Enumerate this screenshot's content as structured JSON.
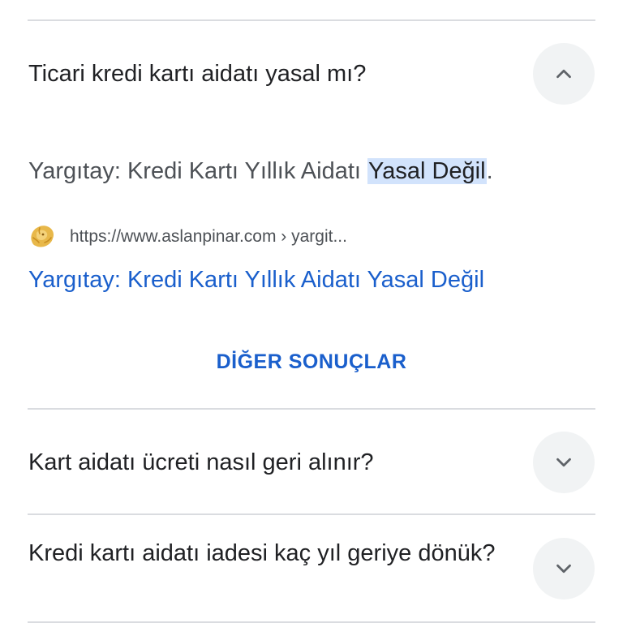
{
  "faq": {
    "q1": {
      "question": "Ticari kredi kartı aidatı yasal mı?",
      "answer_prefix": "Yargıtay: Kredi Kartı Yıllık Aidatı ",
      "answer_highlight": "Yasal Değil",
      "answer_suffix": ".",
      "source_url": "https://www.aslanpinar.com › yargit...",
      "favicon_icon": "lion-logo-icon",
      "result_title": "Yargıtay: Kredi Kartı Yıllık Aidatı Yasal Değil",
      "expanded": true
    },
    "more_results_label": "DİĞER SONUÇLAR",
    "q2": {
      "question": "Kart aidatı ücreti nasıl geri alınır?",
      "expanded": false
    },
    "q3": {
      "question": "Kredi kartı aidatı iadesi kaç yıl geriye dönük?",
      "expanded": false
    }
  },
  "colors": {
    "link": "#1a5fcc",
    "highlight": "#d2e3fc",
    "divider": "#dadce0",
    "button_bg": "#f1f3f4"
  }
}
